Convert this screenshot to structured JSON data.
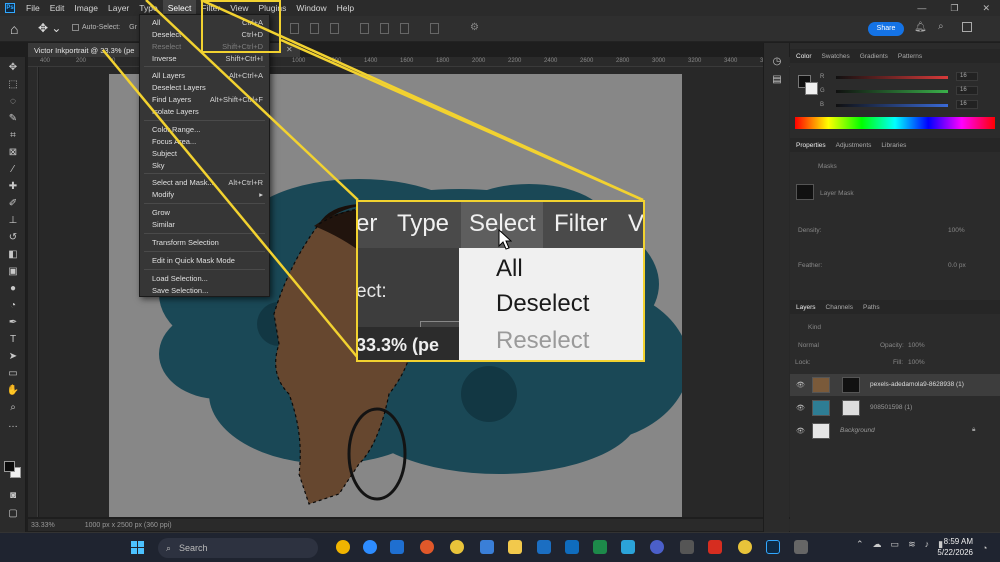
{
  "menubar": {
    "logo": "Ps",
    "items": [
      "File",
      "Edit",
      "Image",
      "Layer",
      "Type",
      "Select",
      "Filter",
      "View",
      "Plugins",
      "Window",
      "Help"
    ],
    "active": "Select"
  },
  "options": {
    "auto_select_label": "Auto-Select:",
    "group_value": "Gr",
    "share_label": "Share"
  },
  "document": {
    "tab_title": "Victor Inkportrait @ 33.3% (pe",
    "zoom": "33.33%",
    "dimensions": "1000 px x 2500 px (360 ppi)",
    "ruler_ticks": [
      "400",
      "200",
      "0",
      "200",
      "400",
      "600",
      "800",
      "1000",
      "1200",
      "1400",
      "1600",
      "1800",
      "2000",
      "2200",
      "2400",
      "2600",
      "2800",
      "3000",
      "3200",
      "3400",
      "3600"
    ]
  },
  "select_menu": {
    "items": [
      {
        "label": "All",
        "shortcut": "Ctrl+A",
        "disabled": false
      },
      {
        "label": "Deselect",
        "shortcut": "Ctrl+D",
        "disabled": false
      },
      {
        "label": "Reselect",
        "shortcut": "Shift+Ctrl+D",
        "disabled": true
      },
      {
        "label": "Inverse",
        "shortcut": "Shift+Ctrl+I",
        "disabled": false
      },
      {
        "label": "All Layers",
        "shortcut": "Alt+Ctrl+A",
        "disabled": false
      },
      {
        "label": "Deselect Layers",
        "shortcut": "",
        "disabled": false
      },
      {
        "label": "Find Layers",
        "shortcut": "Alt+Shift+Ctrl+F",
        "disabled": false
      },
      {
        "label": "Isolate Layers",
        "shortcut": "",
        "disabled": false
      },
      {
        "label": "Color Range...",
        "shortcut": "",
        "disabled": false
      },
      {
        "label": "Focus Area...",
        "shortcut": "",
        "disabled": false
      },
      {
        "label": "Subject",
        "shortcut": "",
        "disabled": false
      },
      {
        "label": "Sky",
        "shortcut": "",
        "disabled": false
      },
      {
        "label": "Select and Mask...",
        "shortcut": "Alt+Ctrl+R",
        "disabled": false
      },
      {
        "label": "Modify",
        "shortcut": "▸",
        "disabled": false
      },
      {
        "label": "Grow",
        "shortcut": "",
        "disabled": false
      },
      {
        "label": "Similar",
        "shortcut": "",
        "disabled": false
      },
      {
        "label": "Transform Selection",
        "shortcut": "",
        "disabled": false
      },
      {
        "label": "Edit in Quick Mask Mode",
        "shortcut": "",
        "disabled": false
      },
      {
        "label": "Load Selection...",
        "shortcut": "",
        "disabled": false
      },
      {
        "label": "Save Selection...",
        "shortcut": "",
        "disabled": false
      }
    ]
  },
  "callout": {
    "menubar": [
      "er",
      "Type",
      "Select",
      "Filter",
      "V"
    ],
    "options_text": "ect:",
    "options_group": "Gr",
    "zoom_text": "33.3% (pe",
    "dropdown": [
      {
        "label": "All",
        "disabled": false
      },
      {
        "label": "Deselect",
        "disabled": false
      },
      {
        "label": "Reselect",
        "disabled": true
      }
    ]
  },
  "panels": {
    "color_tabs": [
      "Color",
      "Swatches",
      "Gradients",
      "Patterns"
    ],
    "channels": [
      {
        "label": "R",
        "value": "16",
        "color": "#d83a3a"
      },
      {
        "label": "G",
        "value": "16",
        "color": "#3ab04a"
      },
      {
        "label": "B",
        "value": "16",
        "color": "#3a6ad8"
      }
    ],
    "properties_tabs": [
      "Properties",
      "Adjustments",
      "Libraries"
    ],
    "masks_label": "Masks",
    "layer_mask_label": "Layer Mask",
    "density_label": "Density:",
    "density_value": "100%",
    "feather_label": "Feather:",
    "feather_value": "0.0 px",
    "layers_tabs": [
      "Layers",
      "Channels",
      "Paths"
    ],
    "kind_label": "Kind",
    "blend_mode": "Normal",
    "opacity_label": "Opacity:",
    "opacity_value": "100%",
    "lock_label": "Lock:",
    "fill_label": "Fill:",
    "fill_value": "100%",
    "layers": [
      {
        "name": "pexels-adedamola9-8628938 (1)",
        "selected": true
      },
      {
        "name": "908501598 (1)",
        "selected": false
      },
      {
        "name": "Background",
        "selected": false
      }
    ]
  },
  "taskbar": {
    "search_placeholder": "Search",
    "time": "8:59 AM",
    "date": "5/22/2026"
  },
  "colors": {
    "accent_yellow": "#f2d230",
    "ink_blue": "#2e7d94",
    "share_blue": "#1473e6"
  }
}
